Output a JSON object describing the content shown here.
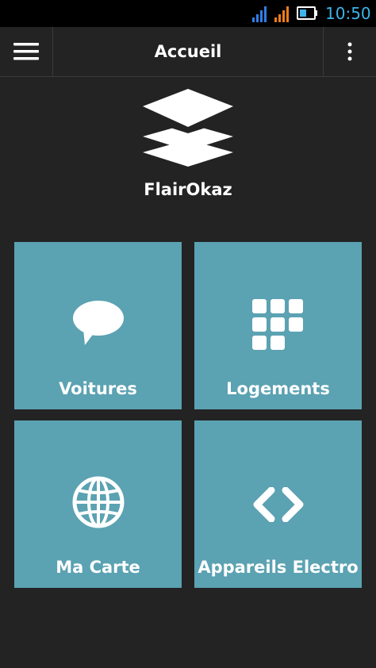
{
  "status_bar": {
    "time": "10:50",
    "signal_icon_1": "signal-bars-icon",
    "signal_icon_2": "signal-bars-icon",
    "battery_icon": "battery-icon",
    "colors": {
      "signal_1": "#2f7de8",
      "signal_2": "#f07c1a",
      "clock": "#3db4ea"
    }
  },
  "app_bar": {
    "title": "Accueil",
    "menu_icon": "hamburger-menu-icon",
    "overflow_icon": "vertical-dots-icon"
  },
  "header": {
    "logo_icon": "layers-stack-icon",
    "app_name": "FlairOkaz"
  },
  "tiles": [
    {
      "label": "Voitures",
      "icon": "speech-bubble-icon"
    },
    {
      "label": "Logements",
      "icon": "grid-blocks-icon"
    },
    {
      "label": "Ma Carte",
      "icon": "globe-icon"
    },
    {
      "label": "Appareils Electro",
      "icon": "code-brackets-icon"
    }
  ],
  "colors": {
    "background": "#232323",
    "tile": "#5ba2b2",
    "text": "#ffffff"
  }
}
